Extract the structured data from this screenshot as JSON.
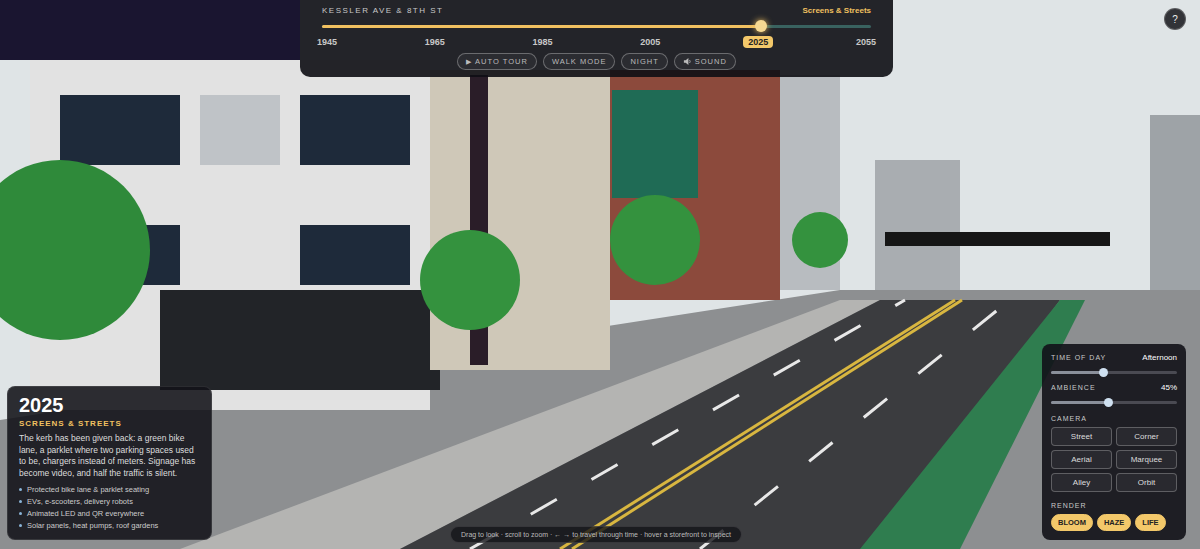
{
  "header": {
    "location": "KESSLER AVE & 8TH ST",
    "era": "Screens & Streets"
  },
  "timeline": {
    "level": 0.8,
    "years": [
      {
        "label": "1945",
        "selected": false
      },
      {
        "label": "1965",
        "selected": false
      },
      {
        "label": "1985",
        "selected": false
      },
      {
        "label": "2005",
        "selected": false
      },
      {
        "label": "2025",
        "selected": true
      },
      {
        "label": "2055",
        "selected": false
      }
    ]
  },
  "controls": [
    {
      "label": "AUTO TOUR",
      "kind": "glyph",
      "glyph": "▶",
      "on": false
    },
    {
      "label": "WALK MODE",
      "kind": "plain",
      "on": false
    },
    {
      "label": "NIGHT",
      "kind": "plain",
      "on": false
    },
    {
      "label": "SOUND",
      "kind": "speaker",
      "on": false
    }
  ],
  "help": "?",
  "info": {
    "year": "2025",
    "title": "SCREENS & STREETS",
    "description": "The kerb has been given back: a green bike lane, a parklet where two parking spaces used to be, chargers instead of meters. Signage has become video, and half the traffic is silent.",
    "features": [
      "Protected bike lane & parklet seating",
      "EVs, e-scooters, delivery robots",
      "Animated LED and QR everywhere",
      "Solar panels, heat pumps, roof gardens"
    ]
  },
  "hint": "Drag to look · scroll to zoom · ← → to travel through time · hover a storefront to inspect",
  "settings": {
    "sliders": [
      {
        "label": "TIME OF DAY",
        "reading": "Afternoon",
        "level": 0.42
      },
      {
        "label": "AMBIENCE",
        "reading": "45%",
        "level": 0.46
      }
    ],
    "camera": {
      "label": "CAMERA",
      "options": [
        {
          "label": "Street",
          "selected": false
        },
        {
          "label": "Corner",
          "selected": false
        },
        {
          "label": "Aerial",
          "selected": false
        },
        {
          "label": "Marquee",
          "selected": false
        },
        {
          "label": "Alley",
          "selected": false
        },
        {
          "label": "Orbit",
          "selected": false
        }
      ]
    },
    "render": {
      "label": "RENDER",
      "options": [
        {
          "label": "BLOOM",
          "on": true
        },
        {
          "label": "HAZE",
          "on": true
        },
        {
          "label": "LIFE",
          "on": true
        }
      ]
    }
  }
}
